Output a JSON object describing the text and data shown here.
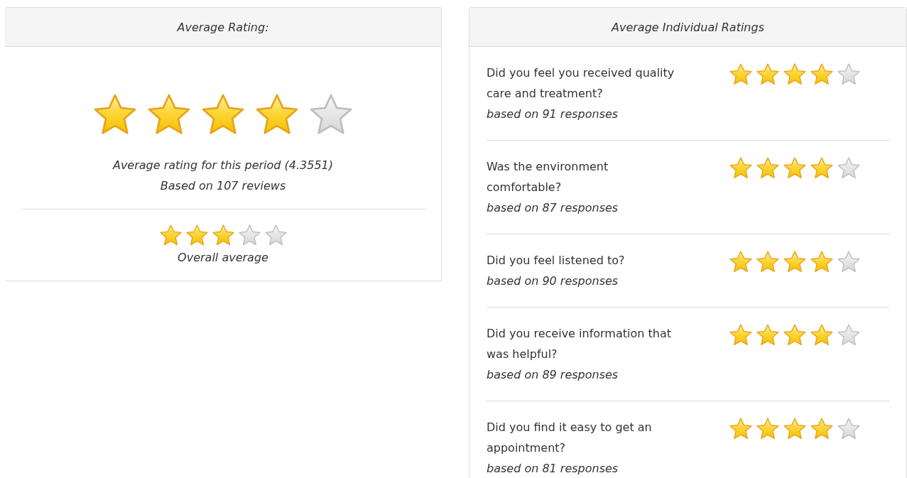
{
  "average_rating": {
    "title": "Average Rating:",
    "stars": 4,
    "summary": "Average rating for this period (4.3551)",
    "review_count": "Based on 107 reviews",
    "overall": {
      "stars": 3,
      "label": "Overall average"
    }
  },
  "individual_ratings": {
    "title": "Average Individual Ratings",
    "items": [
      {
        "question": "Did you feel you received quality care and treatment?",
        "responses": "based on 91 responses",
        "stars": 4
      },
      {
        "question": "Was the environment comfortable?",
        "responses": "based on 87 responses",
        "stars": 4
      },
      {
        "question": "Did you feel listened to?",
        "responses": "based on 90 responses",
        "stars": 4
      },
      {
        "question": "Did you receive information that was helpful?",
        "responses": "based on 89 responses",
        "stars": 4
      },
      {
        "question": "Did you find it easy to get an appointment?",
        "responses": "based on 81 responses",
        "stars": 4
      }
    ]
  }
}
